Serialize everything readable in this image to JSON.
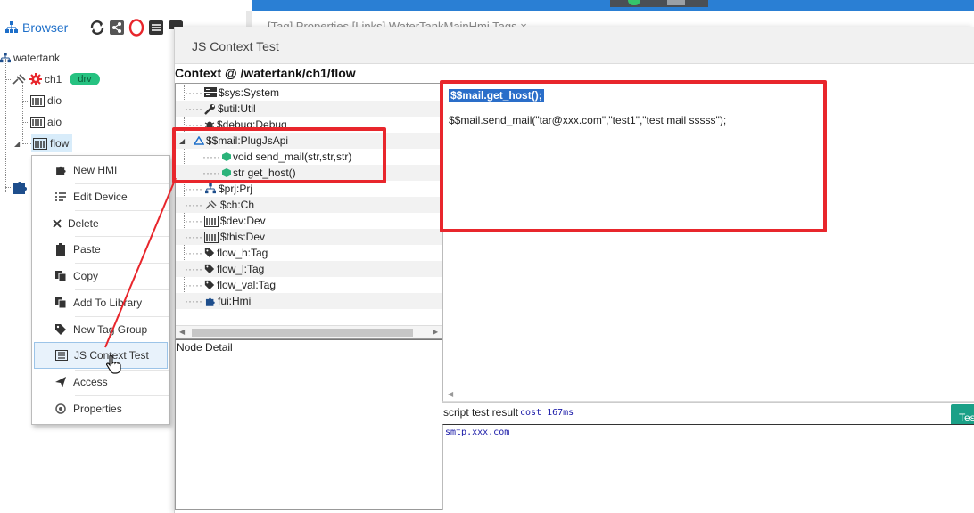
{
  "browser": {
    "title": "Browser",
    "toolbar_icons": [
      "refresh-icon",
      "share-icon",
      "circle-icon",
      "list-icon",
      "database-icon"
    ]
  },
  "left_tree": {
    "root": "watertank",
    "channel": "ch1",
    "channel_badge": "drv",
    "items": [
      "dio",
      "aio",
      "flow"
    ],
    "selected": "flow"
  },
  "context_menu": {
    "items": [
      {
        "label": "New HMI",
        "icon": "puzzle-icon"
      },
      {
        "label": "Edit Device",
        "icon": "edit-list-icon"
      },
      {
        "label": "Delete",
        "icon": "close-icon"
      },
      {
        "label": "Paste",
        "icon": "clipboard-icon"
      },
      {
        "label": "Copy",
        "icon": "copy-icon"
      },
      {
        "label": "Add To Library",
        "icon": "library-icon"
      },
      {
        "label": "New Tag Group",
        "icon": "tag-icon"
      },
      {
        "label": "JS Context Test",
        "icon": "console-icon"
      },
      {
        "label": "Access",
        "icon": "send-icon"
      },
      {
        "label": "Properties",
        "icon": "gear-icon"
      }
    ],
    "highlighted": "JS Context Test"
  },
  "dialog": {
    "title": "JS Context Test",
    "context_path": "Context @ /watertank/ch1/flow",
    "tree_nodes": [
      {
        "label": "$sys:System",
        "icon": "server-icon"
      },
      {
        "label": "$util:Util",
        "icon": "wrench-icon"
      },
      {
        "label": "$debug:Debug",
        "icon": "bug-icon"
      },
      {
        "label": "$$mail:PlugJsApi",
        "icon": "plugin-icon",
        "expanded": true
      },
      {
        "label": "void send_mail(str,str,str)",
        "icon": "method-icon",
        "child": true
      },
      {
        "label": "str get_host()",
        "icon": "method-icon",
        "child": true
      },
      {
        "label": "$prj:Prj",
        "icon": "project-icon"
      },
      {
        "label": "$ch:Ch",
        "icon": "channel-icon"
      },
      {
        "label": "$dev:Dev",
        "icon": "device-icon"
      },
      {
        "label": "$this:Dev",
        "icon": "device-icon"
      },
      {
        "label": "flow_h:Tag",
        "icon": "tag-icon"
      },
      {
        "label": "flow_l:Tag",
        "icon": "tag-icon"
      },
      {
        "label": "flow_val:Tag",
        "icon": "tag-icon"
      },
      {
        "label": "fui:Hmi",
        "icon": "puzzle-icon"
      }
    ],
    "node_detail_label": "Node Detail",
    "code_lines": [
      "$$mail.get_host();",
      "$$mail.send_mail(\"tar@xxx.com\",\"test1\",\"test mail sssss\");"
    ],
    "result_label": "script test result",
    "result_cost": "cost 167ms",
    "result_output": "smtp.xxx.com",
    "test_button": "Tes"
  },
  "background_tabs": "[Tag]     Properties     [Links]     WaterTankMainHmi     Tags     ×",
  "colors": {
    "accent_blue": "#1e6fc9",
    "annotation_red": "#e8262c",
    "badge_green": "#26c281",
    "test_button": "#1aa087",
    "selection_blue": "#2a6ec9"
  }
}
